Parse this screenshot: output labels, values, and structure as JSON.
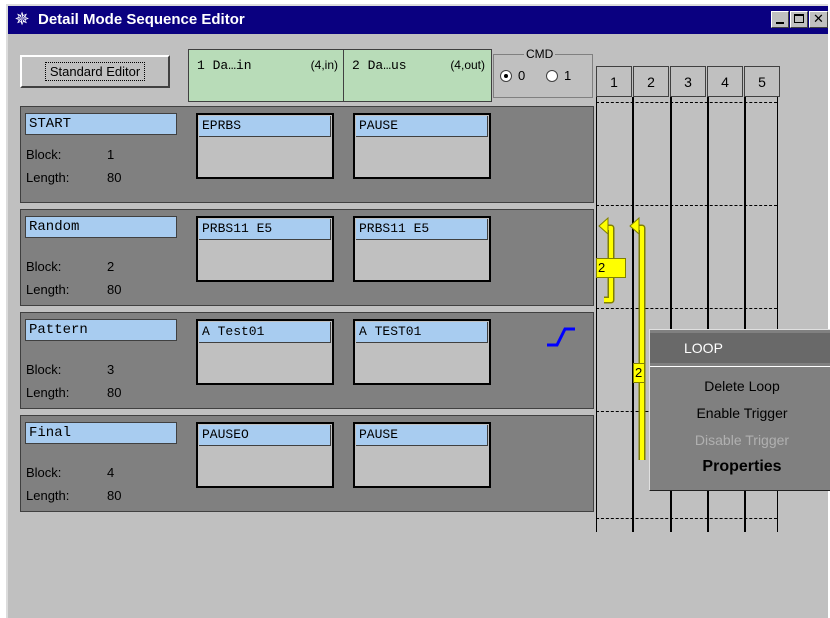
{
  "window": {
    "title": "Detail Mode Sequence Editor",
    "icon": "app-star-icon",
    "controls": [
      "minimize-icon",
      "maximize-icon",
      "close-icon"
    ]
  },
  "toolbar": {
    "standard_editor_label": "Standard Editor",
    "ports": [
      {
        "name": "1 Da…in",
        "io": "(4,in)"
      },
      {
        "name": "2 Da…us",
        "io": "(4,out)"
      }
    ],
    "cmd": {
      "title": "CMD",
      "options": [
        "0",
        "1"
      ],
      "selected": "0"
    }
  },
  "labels": {
    "block": "Block:",
    "length": "Length:"
  },
  "blocks": [
    {
      "name": "START",
      "block": "1",
      "length": "80",
      "segments": [
        "EPRBS",
        "PAUSE"
      ]
    },
    {
      "name": "Random",
      "block": "2",
      "length": "80",
      "segments": [
        "PRBS11 E5",
        "PRBS11 E5"
      ]
    },
    {
      "name": "Pattern",
      "block": "3",
      "length": "80",
      "segments": [
        "A Test01",
        "A TEST01"
      ],
      "icon": "trigger-edge-icon"
    },
    {
      "name": "Final",
      "block": "4",
      "length": "80",
      "segments": [
        "PAUSEO",
        "PAUSE"
      ]
    }
  ],
  "grid": {
    "columns": [
      "1",
      "2",
      "3",
      "4",
      "5"
    ],
    "loops": [
      {
        "label": "2",
        "color": "#ffff00"
      },
      {
        "label": "2",
        "color": "#ffff00"
      }
    ]
  },
  "context_menu": {
    "header": "LOOP",
    "items": [
      {
        "label": "Delete Loop",
        "enabled": true
      },
      {
        "label": "Enable Trigger",
        "enabled": true
      },
      {
        "label": "Disable Trigger",
        "enabled": false
      },
      {
        "label": "Properties",
        "enabled": true,
        "bold": true
      }
    ]
  },
  "colors": {
    "titlebar": "#0a0080",
    "block_bg": "#808080",
    "label_blue": "#a8ccf0",
    "port_green": "#b8dcb8",
    "loop_yellow": "#ffff00",
    "trigger_blue": "#0000ff"
  }
}
